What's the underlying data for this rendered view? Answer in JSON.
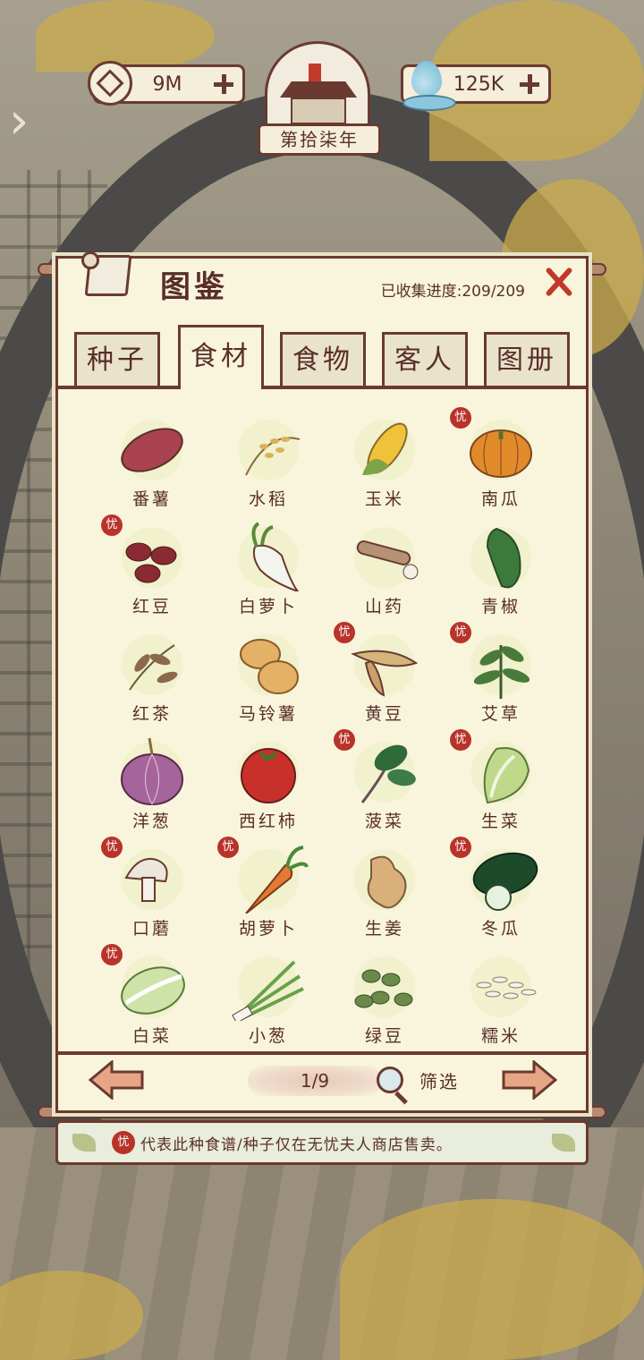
{
  "top_bar": {
    "coins": "9M",
    "water": "125K",
    "year": "第拾柒年"
  },
  "panel": {
    "title": "图鉴",
    "progress": "已收集进度:209/209"
  },
  "tabs": [
    {
      "label": "种子",
      "active": false
    },
    {
      "label": "食材",
      "active": true
    },
    {
      "label": "食物",
      "active": false
    },
    {
      "label": "客人",
      "active": false
    },
    {
      "label": "图册",
      "active": false
    }
  ],
  "badge_char": "忧",
  "items": [
    {
      "name": "番薯",
      "icon": "sweet-potato-icon",
      "exclusive": false
    },
    {
      "name": "水稻",
      "icon": "rice-icon",
      "exclusive": false
    },
    {
      "name": "玉米",
      "icon": "corn-icon",
      "exclusive": false
    },
    {
      "name": "南瓜",
      "icon": "pumpkin-icon",
      "exclusive": true
    },
    {
      "name": "红豆",
      "icon": "red-bean-icon",
      "exclusive": true
    },
    {
      "name": "白萝卜",
      "icon": "white-radish-icon",
      "exclusive": false
    },
    {
      "name": "山药",
      "icon": "yam-icon",
      "exclusive": false
    },
    {
      "name": "青椒",
      "icon": "green-pepper-icon",
      "exclusive": false
    },
    {
      "name": "红茶",
      "icon": "black-tea-icon",
      "exclusive": false
    },
    {
      "name": "马铃薯",
      "icon": "potato-icon",
      "exclusive": false
    },
    {
      "name": "黄豆",
      "icon": "soybean-icon",
      "exclusive": true
    },
    {
      "name": "艾草",
      "icon": "mugwort-icon",
      "exclusive": true
    },
    {
      "name": "洋葱",
      "icon": "onion-icon",
      "exclusive": false
    },
    {
      "name": "西红柿",
      "icon": "tomato-icon",
      "exclusive": false
    },
    {
      "name": "菠菜",
      "icon": "spinach-icon",
      "exclusive": true
    },
    {
      "name": "生菜",
      "icon": "lettuce-icon",
      "exclusive": true
    },
    {
      "name": "口蘑",
      "icon": "mushroom-icon",
      "exclusive": true
    },
    {
      "name": "胡萝卜",
      "icon": "carrot-icon",
      "exclusive": true
    },
    {
      "name": "生姜",
      "icon": "ginger-icon",
      "exclusive": false
    },
    {
      "name": "冬瓜",
      "icon": "winter-melon-icon",
      "exclusive": true
    },
    {
      "name": "白菜",
      "icon": "cabbage-icon",
      "exclusive": true
    },
    {
      "name": "小葱",
      "icon": "scallion-icon",
      "exclusive": false
    },
    {
      "name": "绿豆",
      "icon": "mung-bean-icon",
      "exclusive": false
    },
    {
      "name": "糯米",
      "icon": "glutinous-rice-icon",
      "exclusive": false
    }
  ],
  "pagination": {
    "page": "1/9",
    "filter": "筛选"
  },
  "notice": "代表此种食谱/种子仅在无忧夫人商店售卖。",
  "colors": {
    "accent_red": "#b8332a",
    "ink": "#5a2e28",
    "paper": "#f8f5dc"
  }
}
